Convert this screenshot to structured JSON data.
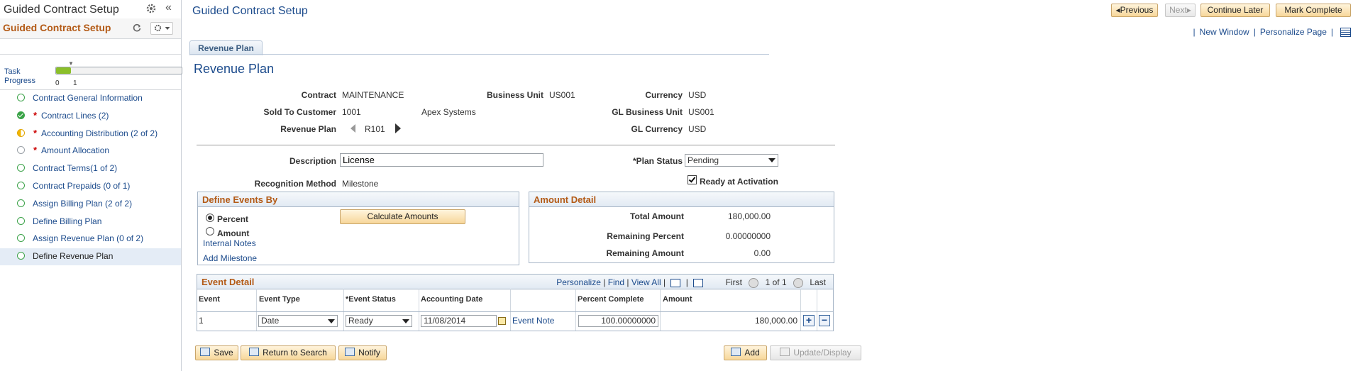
{
  "sidebar": {
    "title": "Guided Contract Setup",
    "subtitle": "Guided Contract Setup",
    "collapse_glyph": "«",
    "progress": {
      "label_line1": "Task",
      "label_line2": "Progress",
      "tick_start": "0",
      "tick_end": "1",
      "fraction": 0.12
    },
    "steps": [
      {
        "label": "Contract General Information",
        "status": "open",
        "required": ""
      },
      {
        "label": "Contract Lines (2)",
        "status": "done",
        "required": "*"
      },
      {
        "label": "Accounting Distribution (2 of 2)",
        "status": "partial",
        "required": "*"
      },
      {
        "label": "Amount Allocation",
        "status": "none",
        "required": "*"
      },
      {
        "label": "Contract Terms(1 of 2)",
        "status": "open",
        "required": ""
      },
      {
        "label": "Contract Prepaids (0 of 1)",
        "status": "open",
        "required": ""
      },
      {
        "label": "Assign Billing Plan (2 of 2)",
        "status": "open",
        "required": ""
      },
      {
        "label": "Define Billing Plan",
        "status": "open",
        "required": ""
      },
      {
        "label": "Assign Revenue Plan (0 of 2)",
        "status": "open",
        "required": ""
      },
      {
        "label": "Define Revenue Plan",
        "status": "open",
        "required": "",
        "active": true
      }
    ]
  },
  "header": {
    "title": "Guided Contract Setup",
    "previous_label": "Previous",
    "next_label": "Next",
    "continue_later_label": "Continue Later",
    "mark_complete_label": "Mark Complete",
    "new_window_label": "New Window",
    "personalize_page_label": "Personalize Page"
  },
  "tab": {
    "label": "Revenue Plan"
  },
  "page": {
    "title": "Revenue Plan",
    "contract_label": "Contract",
    "contract_value": "MAINTENANCE",
    "business_unit_label": "Business Unit",
    "business_unit_value": "US001",
    "currency_label": "Currency",
    "currency_value": "USD",
    "sold_to_label": "Sold To Customer",
    "sold_to_value": "1001",
    "sold_to_name": "Apex Systems",
    "gl_bu_label": "GL Business Unit",
    "gl_bu_value": "US001",
    "revenue_plan_label": "Revenue Plan",
    "revenue_plan_value": "R101",
    "gl_currency_label": "GL Currency",
    "gl_currency_value": "USD",
    "description_label": "Description",
    "description_value": "License",
    "plan_status_label": "*Plan Status",
    "plan_status_value": "Pending",
    "ready_label": "Ready at Activation",
    "recognition_label": "Recognition Method",
    "recognition_value": "Milestone"
  },
  "define_events": {
    "title": "Define Events By",
    "percent_label": "Percent",
    "amount_label": "Amount",
    "selected": "percent",
    "calculate_label": "Calculate Amounts",
    "internal_notes_label": "Internal Notes",
    "add_milestone_label": "Add Milestone"
  },
  "amount_detail": {
    "title": "Amount Detail",
    "total_label": "Total Amount",
    "total_value": "180,000.00",
    "rem_pct_label": "Remaining Percent",
    "rem_pct_value": "0.00000000",
    "rem_amt_label": "Remaining Amount",
    "rem_amt_value": "0.00"
  },
  "event_detail": {
    "title": "Event Detail",
    "personalize_label": "Personalize",
    "find_label": "Find",
    "view_all_label": "View All",
    "first_label": "First",
    "page_indicator": "1 of 1",
    "last_label": "Last",
    "columns": [
      "Event",
      "Event Type",
      "*Event Status",
      "Accounting Date",
      "Percent Complete",
      "Amount"
    ],
    "rows": [
      {
        "event": "1",
        "event_type": "Date",
        "event_status": "Ready",
        "accounting_date": "11/08/2014",
        "event_note": "Event Note",
        "percent": "100.00000000",
        "amount": "180,000.00"
      }
    ]
  },
  "footer": {
    "save_label": "Save",
    "return_label": "Return to Search",
    "notify_label": "Notify",
    "add_label": "Add",
    "update_label": "Update/Display"
  },
  "colors": {
    "link": "#1c4b8c",
    "section_title": "#b35a16",
    "button_fill": "#f7d79a",
    "progress_fill": "#8bbf2a"
  }
}
